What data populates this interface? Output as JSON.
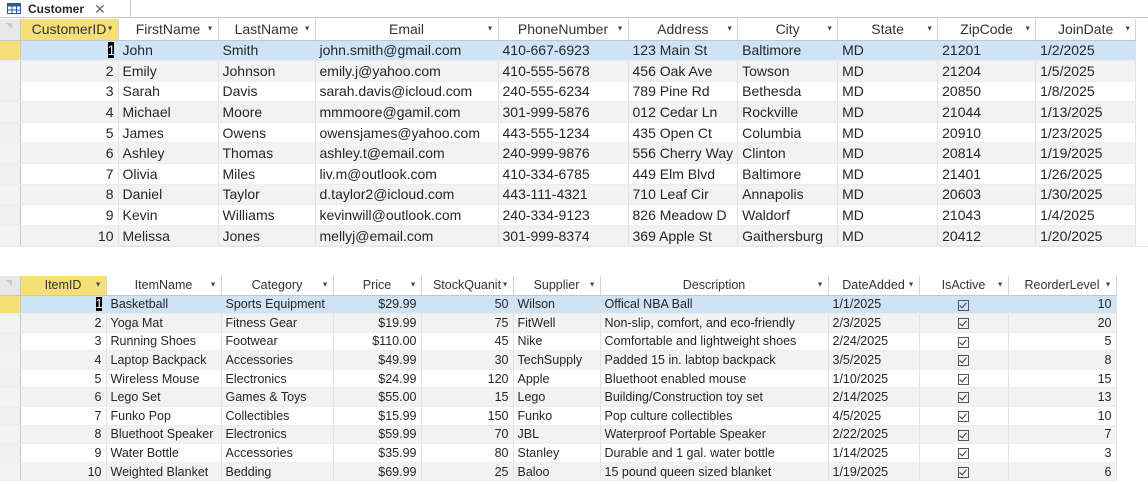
{
  "tab": {
    "label": "Customer",
    "close": "✕"
  },
  "customer": {
    "columns": [
      "CustomerID",
      "FirstName",
      "LastName",
      "Email",
      "PhoneNumber",
      "Address",
      "City",
      "State",
      "ZipCode",
      "JoinDate"
    ],
    "rows": [
      [
        "1",
        "John",
        "Smith",
        "john.smith@gmail.com",
        "410-667-6923",
        "123 Main St",
        "Baltimore",
        "MD",
        "21201",
        "1/2/2025"
      ],
      [
        "2",
        "Emily",
        "Johnson",
        "emily.j@yahoo.com",
        "410-555-5678",
        "456 Oak Ave",
        "Towson",
        "MD",
        "21204",
        "1/5/2025"
      ],
      [
        "3",
        "Sarah",
        "Davis",
        "sarah.davis@icloud.com",
        "240-555-6234",
        "789 Pine Rd",
        "Bethesda",
        "MD",
        "20850",
        "1/8/2025"
      ],
      [
        "4",
        "Michael",
        "Moore",
        "mmmoore@gamil.com",
        "301-999-5876",
        "012 Cedar Ln",
        "Rockville",
        "MD",
        "21044",
        "1/13/2025"
      ],
      [
        "5",
        "James",
        "Owens",
        "owensjames@yahoo.com",
        "443-555-1234",
        "435 Open Ct",
        "Columbia",
        "MD",
        "20910",
        "1/23/2025"
      ],
      [
        "6",
        "Ashley",
        "Thomas",
        "ashley.t@email.com",
        "240-999-9876",
        "556 Cherry Way",
        "Clinton",
        "MD",
        "20814",
        "1/19/2025"
      ],
      [
        "7",
        "Olivia",
        "Miles",
        "liv.m@outlook.com",
        "410-334-6785",
        "449 Elm Blvd",
        "Baltimore",
        "MD",
        "21401",
        "1/26/2025"
      ],
      [
        "8",
        "Daniel",
        "Taylor",
        "d.taylor2@icloud.com",
        "443-111-4321",
        "710 Leaf Cir",
        "Annapolis",
        "MD",
        "20603",
        "1/30/2025"
      ],
      [
        "9",
        "Kevin",
        "Williams",
        "kevinwill@outlook.com",
        "240-334-9123",
        "826 Meadow D",
        "Waldorf",
        "MD",
        "21043",
        "1/4/2025"
      ],
      [
        "10",
        "Melissa",
        "Jones",
        "mellyj@email.com",
        "301-999-8374",
        "369 Apple St",
        "Gaithersburg",
        "MD",
        "20412",
        "1/20/2025"
      ]
    ]
  },
  "items": {
    "columns": [
      "ItemID",
      "ItemName",
      "Category",
      "Price",
      "StockQuanit",
      "Supplier",
      "Description",
      "DateAdded",
      "IsActive",
      "ReorderLevel"
    ],
    "rows": [
      [
        "1",
        "Basketball",
        "Sports Equipment",
        "$29.99",
        "50",
        "Wilson",
        "Offical NBA Ball",
        "1/1/2025",
        "checked",
        "10"
      ],
      [
        "2",
        "Yoga Mat",
        "Fitness Gear",
        "$19.99",
        "75",
        "FitWell",
        "Non-slip, comfort, and eco-friendly",
        "2/3/2025",
        "checked",
        "20"
      ],
      [
        "3",
        "Running Shoes",
        "Footwear",
        "$110.00",
        "45",
        "Nike",
        "Comfortable and lightweight shoes",
        "2/24/2025",
        "checked",
        "5"
      ],
      [
        "4",
        "Laptop Backpack",
        "Accessories",
        "$49.99",
        "30",
        "TechSupply",
        "Padded 15 in. labtop backpack",
        "3/5/2025",
        "checked",
        "8"
      ],
      [
        "5",
        "Wireless Mouse",
        "Electronics",
        "$24.99",
        "120",
        "Apple",
        "Bluethoot enabled mouse",
        "1/10/2025",
        "checked",
        "15"
      ],
      [
        "6",
        "Lego Set",
        "Games & Toys",
        "$55.00",
        "15",
        "Lego",
        "Building/Construction toy set",
        "2/14/2025",
        "checked",
        "13"
      ],
      [
        "7",
        "Funko Pop",
        "Collectibles",
        "$15.99",
        "150",
        "Funko",
        "Pop culture collectibles",
        "4/5/2025",
        "checked",
        "10"
      ],
      [
        "8",
        "Bluethoot Speaker",
        "Electronics",
        "$59.99",
        "70",
        "JBL",
        "Waterproof Portable Speaker",
        "2/22/2025",
        "checked",
        "7"
      ],
      [
        "9",
        "Water Bottle",
        "Accessories",
        "$35.99",
        "80",
        "Stanley",
        "Durable and 1 gal. water bottle",
        "1/14/2025",
        "checked",
        "3"
      ],
      [
        "10",
        "Weighted Blanket",
        "Bedding",
        "$69.99",
        "25",
        "Baloo",
        "15 pound queen sized blanket",
        "1/19/2025",
        "checked",
        "6"
      ]
    ]
  },
  "colors": {
    "selected_header": "#f6df77",
    "active_row": "#cfe3f6",
    "alt_row": "#f2f2f2"
  }
}
